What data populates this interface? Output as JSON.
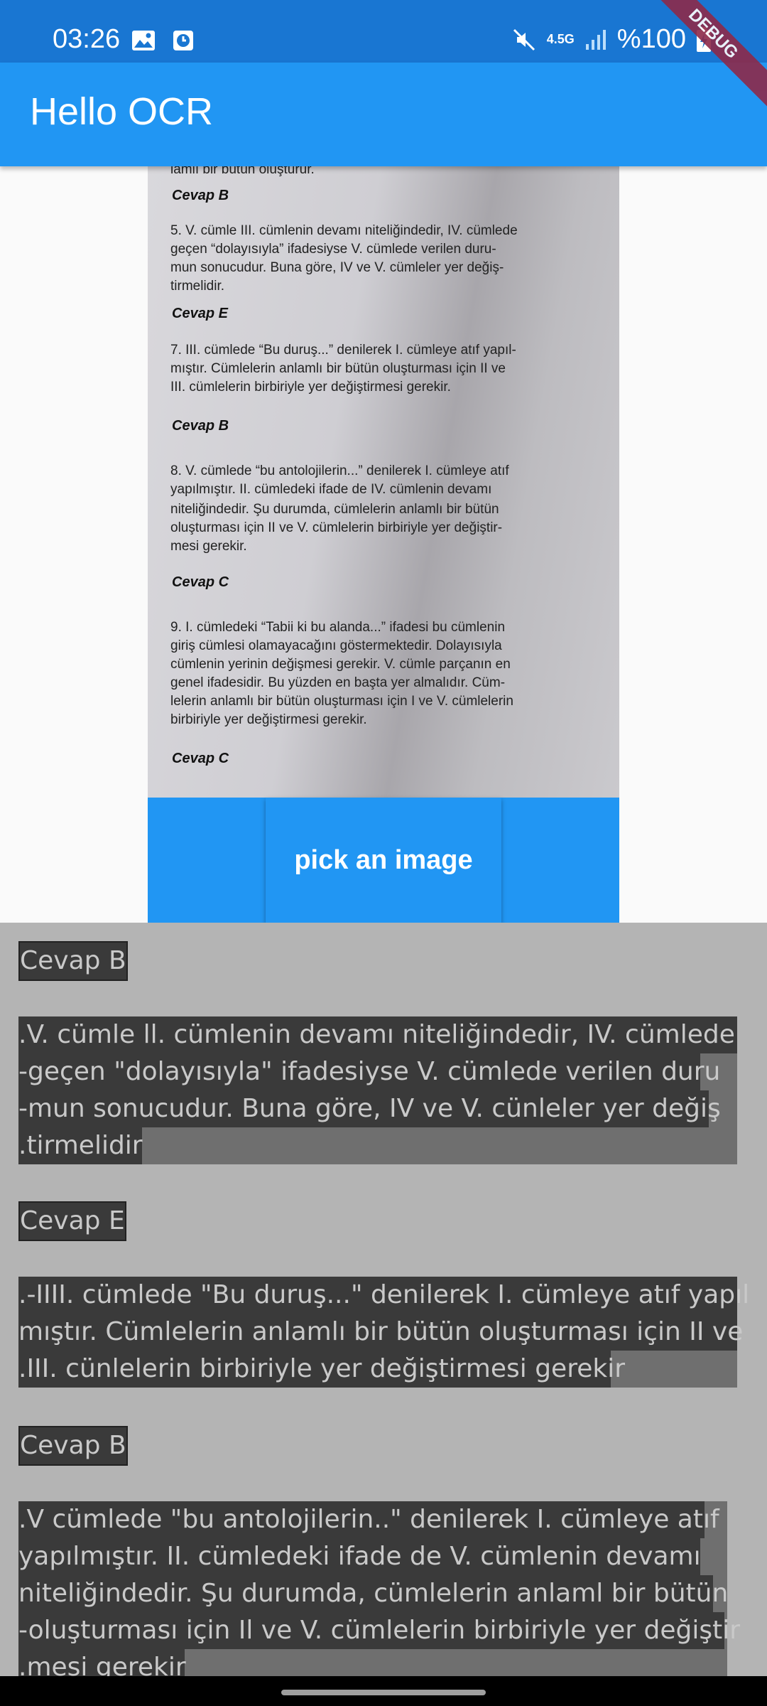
{
  "status": {
    "time": "03:26",
    "network": "4.5G",
    "battery": "%100",
    "icons": [
      "image-icon",
      "clock-icon",
      "mute-icon",
      "signal-icon",
      "battery-charging-icon"
    ]
  },
  "app": {
    "title": "Hello OCR",
    "debug_banner": "DEBUG"
  },
  "photo": {
    "lines": [
      "lamlı bir bütün oluşturur.",
      "Cevap B",
      "5.  V. cümle III. cümlenin devamı niteliğindedir, IV. cümlede",
      "geçen “dolayısıyla” ifadesiyse V. cümlede verilen duru-",
      "mun sonucudur. Buna göre, IV ve V. cümleler yer değiş-",
      "tirmelidir.",
      "Cevap E",
      "7.  III. cümlede “Bu duruş...” denilerek I. cümleye atıf yapıl-",
      "mıştır. Cümlelerin anlamlı bir bütün oluşturması için II ve",
      "III. cümlelerin birbiriyle yer değiştirmesi gerekir.",
      "Cevap B",
      "8.  V. cümlede “bu antolojilerin...”  denilerek I. cümleye atıf",
      "yapılmıştır. II. cümledeki ifade de IV. cümlenin devamı",
      "niteliğindedir. Şu durumda, cümlelerin anlamlı bir bütün",
      "oluşturması için II ve V. cümlelerin birbiriyle yer değiştir-",
      "mesi gerekir.",
      "Cevap C",
      "9.  I. cümledeki “Tabii ki bu alanda...” ifadesi bu cümlenin",
      "giriş cümlesi olamayacağını göstermektedir. Dolayısıyla",
      "cümlenin yerinin değişmesi gerekir. V. cümle parçanın en",
      "genel ifadesidir. Bu yüzden en başta yer almalıdır. Cüm-",
      "lelerin anlamlı bir bütün oluşturması için I ve V. cümlelerin",
      "birbiriyle yer değiştirmesi gerekir.",
      "Cevap C"
    ]
  },
  "button": {
    "pick_label": "pick an image"
  },
  "ocr": {
    "h1": "Cevap B",
    "p1": [
      ".V. cümle ll. cümlenin devamı niteliğindedir, IV. cümlede",
      "-geçen \"dolayısıyla\" ifadesiyse V. cümlede verilen duru",
      "-mun sonucudur. Buna göre, IV ve V. cünleler yer değiş",
      ".tirmelidir"
    ],
    "h2": "Cevap E",
    "p2": [
      ".-IIII. cümlede \"Bu duruş...\" denilerek I. cümleye atıf yapıl",
      "mıştır. Cümlelerin anlamlı bir bütün oluşturması için II ve",
      ".III. cünlelerin birbiriyle yer değiştirmesi gerekir"
    ],
    "h3": "Cevap B",
    "p3": [
      ".V cümlede \"bu antolojilerin..\" denilerek I. cümleye atıf",
      "yapılmıştır. II. cümledeki ifade de V. cümlenin devamı",
      "niteliğindedir. Şu durumda, cümlelerin anlaml bir bütün",
      "-oluşturması için Il ve V. cümlelerin birbiriyle yer değiştir",
      ".mesi gerekir"
    ]
  }
}
